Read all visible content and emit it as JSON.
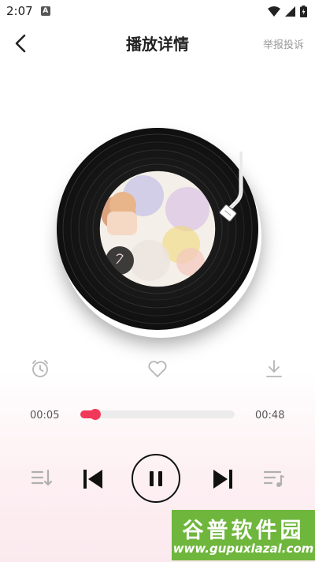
{
  "status_bar": {
    "time": "2:07",
    "notification_icon": "A",
    "icons": [
      "wifi-icon",
      "signal-icon",
      "battery-icon"
    ]
  },
  "nav": {
    "back_icon": "chevron-left-icon",
    "title": "播放详情",
    "report_label": "举报投诉"
  },
  "player": {
    "artwork": "vinyl-record-with-album-art",
    "actions": [
      "alarm-clock-icon",
      "heart-icon",
      "download-icon"
    ],
    "current_time": "00:05",
    "total_time": "00:48",
    "progress": 0.11,
    "controls": [
      "playlist-icon",
      "previous-icon",
      "pause-icon",
      "next-icon",
      "lyrics-icon"
    ]
  },
  "colors": {
    "accent": "#f2385a",
    "watermark_bg": "#6fb63d"
  },
  "watermark": {
    "title": "谷普软件园",
    "url": "www.gupuxlazal.com"
  }
}
